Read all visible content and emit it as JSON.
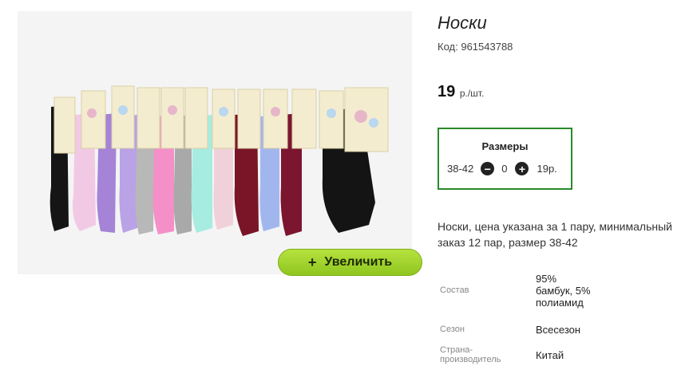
{
  "product": {
    "title": "Носки",
    "code_label": "Код:",
    "code_value": "961543788",
    "price_value": "19",
    "price_unit": "р./шт."
  },
  "image": {
    "zoom_label": "Увеличить",
    "zoom_icon": "plus-icon"
  },
  "sizes": {
    "title": "Размеры",
    "size": "38-42",
    "quantity": "0",
    "price": "19р.",
    "minus_icon": "minus-circle-icon",
    "plus_icon": "plus-circle-icon"
  },
  "description": "Носки, цена указана за 1 пару, минимальный заказ 12 пар, размер 38-42",
  "specs": [
    {
      "key": "Состав",
      "value": "95% бамбук, 5% полиамид"
    },
    {
      "key": "Сезон",
      "value": "Всесезон"
    },
    {
      "key": "Страна-производитель",
      "value": "Китай"
    }
  ],
  "colors": {
    "accent_green": "#2a8a2a",
    "button_green": "#9dd12b"
  }
}
